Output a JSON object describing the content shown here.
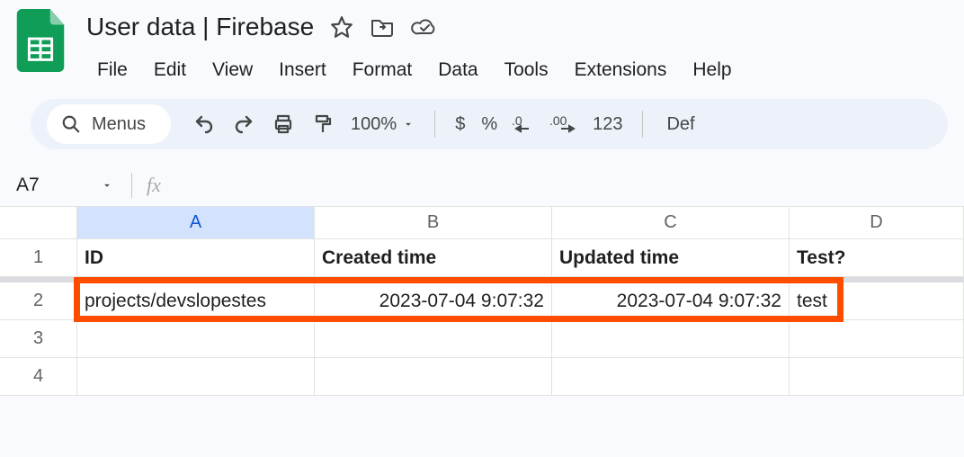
{
  "doc": {
    "title": "User data | Firebase"
  },
  "menu": {
    "file": "File",
    "edit": "Edit",
    "view": "View",
    "insert": "Insert",
    "format": "Format",
    "data": "Data",
    "tools": "Tools",
    "extensions": "Extensions",
    "help": "Help"
  },
  "toolbar": {
    "menus_label": "Menus",
    "zoom": "100%",
    "dollar": "$",
    "percent": "%",
    "number_format": "123",
    "font_truncated": "Def"
  },
  "name_box": "A7",
  "fx_label": "fx",
  "columns": {
    "A": "A",
    "B": "B",
    "C": "C",
    "D": "D"
  },
  "rows": {
    "1": "1",
    "2": "2",
    "3": "3",
    "4": "4"
  },
  "table": {
    "headers": {
      "A": "ID",
      "B": "Created time",
      "C": "Updated time",
      "D": "Test?"
    },
    "row2": {
      "A": "projects/devslopestes",
      "B": "2023-07-04 9:07:32",
      "C": "2023-07-04 9:07:32",
      "D": "test"
    }
  }
}
